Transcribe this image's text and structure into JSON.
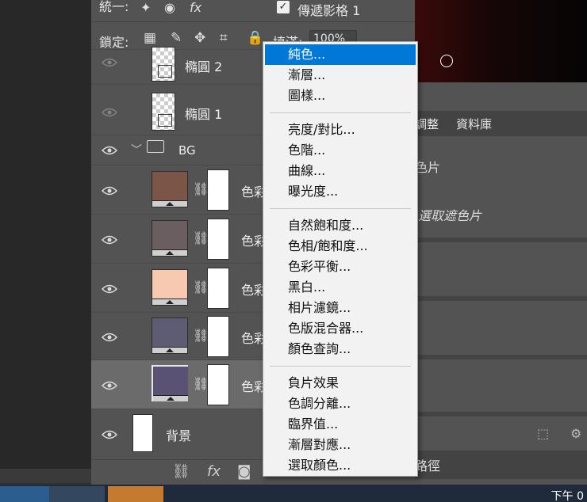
{
  "options_bar": {
    "unify_label": "統一:",
    "propagate_checked": "✓",
    "propagate_label": "傳遞影格 1",
    "lock_label": "鎖定:",
    "fill_label": "填滿:",
    "fill_value": "100%"
  },
  "layers": [
    {
      "name": "橢圓 2",
      "type": "shape"
    },
    {
      "name": "橢圓 1",
      "type": "shape"
    },
    {
      "name": "BG",
      "type": "group"
    },
    {
      "name": "色彩",
      "type": "fill",
      "color": "#7b5648"
    },
    {
      "name": "色彩",
      "type": "fill",
      "color": "#6b5e60"
    },
    {
      "name": "色彩",
      "type": "fill",
      "color": "#f7c9b0"
    },
    {
      "name": "色彩",
      "type": "fill",
      "color": "#5e5c72"
    },
    {
      "name": "色彩",
      "type": "fill",
      "color": "#5a5274",
      "selected": true
    },
    {
      "name": "背景",
      "type": "background"
    }
  ],
  "right_panel": {
    "tab_adjust": "調整",
    "tab_library": "資料庫",
    "text_1": "色片",
    "text_2": "選取遮色片",
    "bottom_tab": "路徑"
  },
  "context_menu": {
    "groups": [
      [
        "純色...",
        "漸層...",
        "圖樣..."
      ],
      [
        "亮度/對比...",
        "色階...",
        "曲線...",
        "曝光度..."
      ],
      [
        "自然飽和度...",
        "色相/飽和度...",
        "色彩平衡...",
        "黑白...",
        "相片濾鏡...",
        "色版混合器...",
        "顏色查詢..."
      ],
      [
        "負片效果",
        "色調分離...",
        "臨界值...",
        "漸層對應...",
        "選取顏色..."
      ]
    ],
    "highlighted": "純色..."
  },
  "taskbar": {
    "time": "下午 0"
  },
  "colors": {
    "menu_highlight": "#0078d7",
    "panel_bg": "#535353"
  }
}
